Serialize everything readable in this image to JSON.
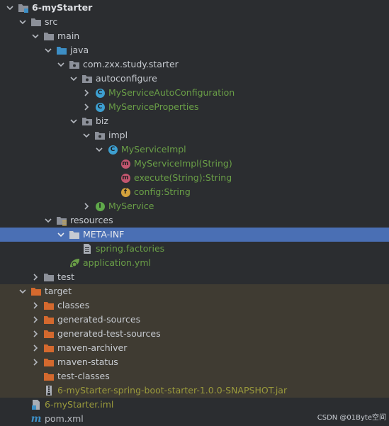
{
  "tree": {
    "project_root": "6-myStarter",
    "src": "src",
    "main": "main",
    "java": "java",
    "package": "com.zxx.study.starter",
    "autoconfigure": "autoconfigure",
    "auto_configuration_class": "MyServiceAutoConfiguration",
    "properties_class": "MyServiceProperties",
    "biz": "biz",
    "impl": "impl",
    "impl_class": "MyServiceImpl",
    "constructor": "MyServiceImpl(String)",
    "method_execute": "execute(String):String",
    "field_config": "config:String",
    "interface": "MyService",
    "resources": "resources",
    "meta_inf": "META-INF",
    "spring_factories": "spring.factories",
    "application_yml": "application.yml",
    "test": "test",
    "target": "target",
    "classes": "classes",
    "generated_sources": "generated-sources",
    "generated_test_sources": "generated-test-sources",
    "maven_archiver": "maven-archiver",
    "maven_status": "maven-status",
    "test_classes": "test-classes",
    "jar_file": "6-myStarter-spring-boot-starter-1.0.0-SNAPSHOT.jar",
    "iml_file": "6-myStarter.iml",
    "pom_file": "pom.xml"
  },
  "icon_letters": {
    "class": "C",
    "interface": "I",
    "method": "m",
    "field": "f",
    "maven": "m"
  },
  "watermark": "CSDN @01Byte空间",
  "colors": {
    "background": "#2b2d30",
    "excluded_bg": "#3f3b32",
    "selection": "#4a6fb4",
    "folder": "#8c9099",
    "source_folder": "#3d8fc6",
    "resource_folder": "#c9a64a",
    "excluded_folder": "#d4692e",
    "class_icon": "#3d9fd0",
    "interface_icon": "#5fa84a",
    "method_icon": "#c3566f",
    "field_icon": "#d3a23c"
  }
}
